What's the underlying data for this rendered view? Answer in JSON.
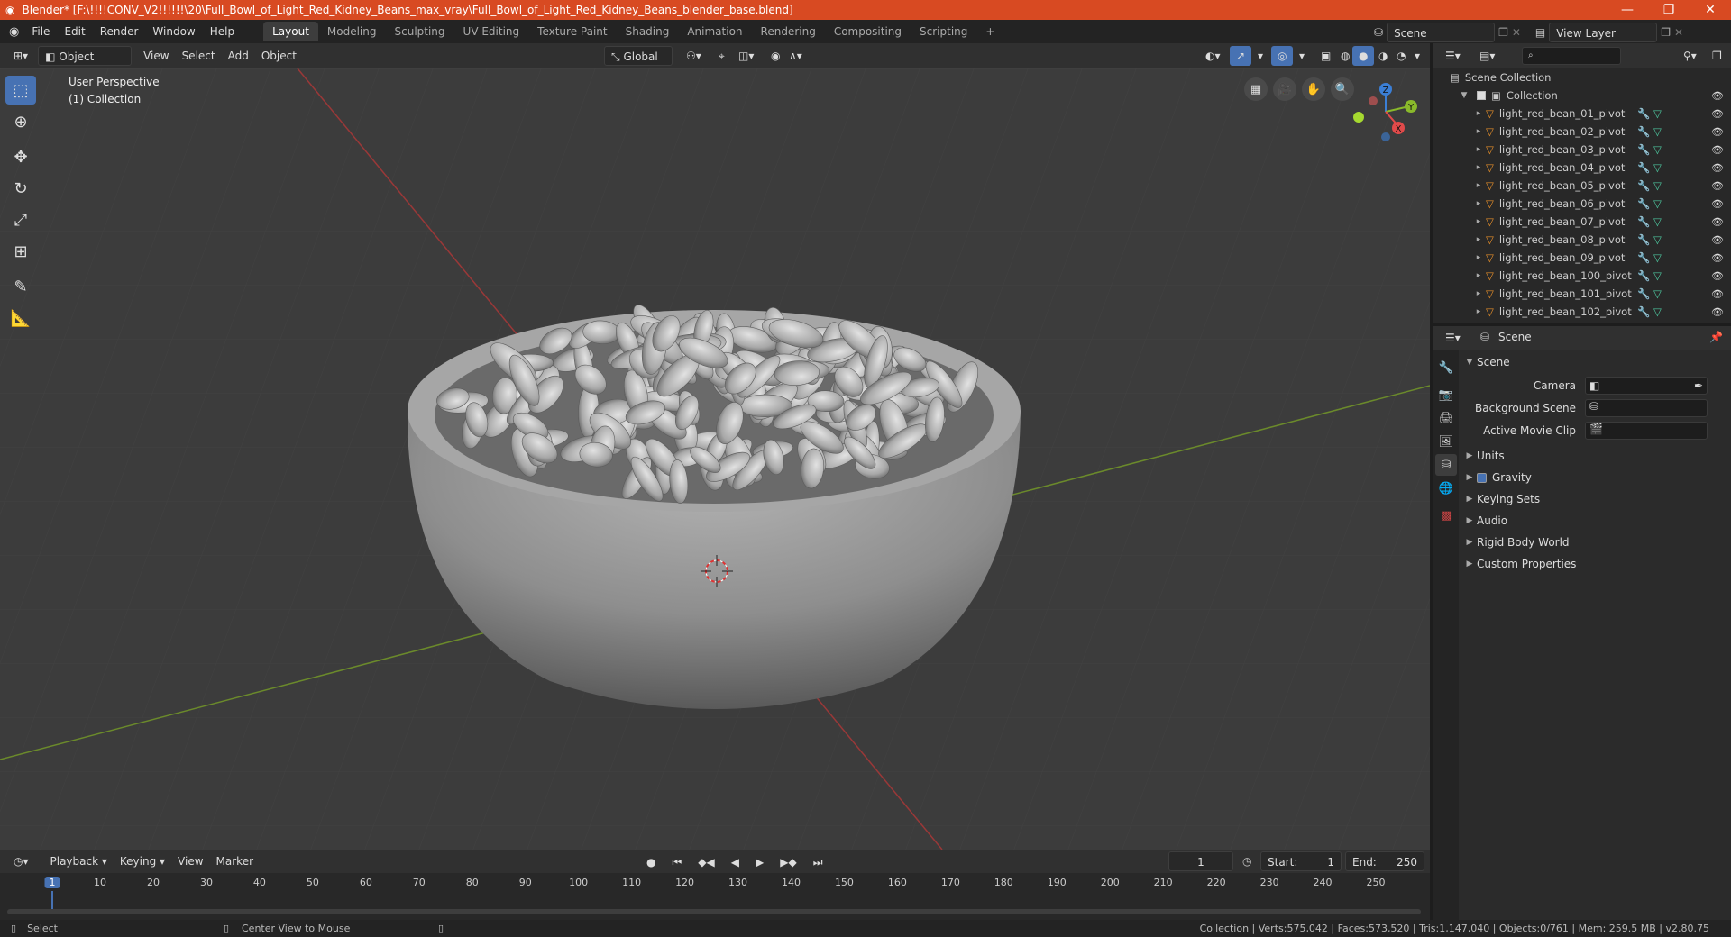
{
  "window": {
    "title": "Blender* [F:\\!!!!CONV_V2!!!!!!\\20\\Full_Bowl_of_Light_Red_Kidney_Beans_max_vray\\Full_Bowl_of_Light_Red_Kidney_Beans_blender_base.blend]"
  },
  "menu": [
    "File",
    "Edit",
    "Render",
    "Window",
    "Help"
  ],
  "workspaces": [
    "Layout",
    "Modeling",
    "Sculpting",
    "UV Editing",
    "Texture Paint",
    "Shading",
    "Animation",
    "Rendering",
    "Compositing",
    "Scripting",
    "+"
  ],
  "active_workspace": "Layout",
  "scene_selector": "Scene",
  "view_layer": "View Layer",
  "viewport_header": {
    "mode": "Object Mode",
    "menus": [
      "View",
      "Select",
      "Add",
      "Object"
    ],
    "transform_orientation": "Global"
  },
  "viewport": {
    "perspective_label": "User Perspective",
    "collection_label": "(1) Collection",
    "gizmo_axes": [
      "Z",
      "Y",
      "X"
    ]
  },
  "outliner": {
    "root": "Scene Collection",
    "collection": "Collection",
    "items": [
      "light_red_bean_01_pivot",
      "light_red_bean_02_pivot",
      "light_red_bean_03_pivot",
      "light_red_bean_04_pivot",
      "light_red_bean_05_pivot",
      "light_red_bean_06_pivot",
      "light_red_bean_07_pivot",
      "light_red_bean_08_pivot",
      "light_red_bean_09_pivot",
      "light_red_bean_100_pivot",
      "light_red_bean_101_pivot",
      "light_red_bean_102_pivot"
    ]
  },
  "properties": {
    "header": "Scene",
    "panel_title": "Scene",
    "fields": {
      "camera": "Camera",
      "background_scene": "Background Scene",
      "active_movie_clip": "Active Movie Clip"
    },
    "sections": [
      "Units",
      "Gravity",
      "Keying Sets",
      "Audio",
      "Rigid Body World",
      "Custom Properties"
    ]
  },
  "timeline": {
    "menus": [
      "Playback",
      "Keying",
      "View",
      "Marker"
    ],
    "current_frame": "1",
    "start_label": "Start:",
    "start": "1",
    "end_label": "End:",
    "end": "250",
    "ticks": [
      "1",
      "10",
      "20",
      "30",
      "40",
      "50",
      "60",
      "70",
      "80",
      "90",
      "100",
      "110",
      "120",
      "130",
      "140",
      "150",
      "160",
      "170",
      "180",
      "190",
      "200",
      "210",
      "220",
      "230",
      "240",
      "250"
    ]
  },
  "statusbar": {
    "left_action": "Select",
    "middle_action": "Center View to Mouse",
    "stats": "Collection | Verts:575,042 | Faces:573,520 | Tris:1,147,040 | Objects:0/761 | Mem: 259.5 MB | v2.80.75"
  },
  "colors": {
    "titlebar": "#d84a22",
    "accent": "#4772b3",
    "viewport_bg": "#3c3c3c",
    "mesh_orange": "#e8902a",
    "data_green": "#4ec9a0"
  }
}
